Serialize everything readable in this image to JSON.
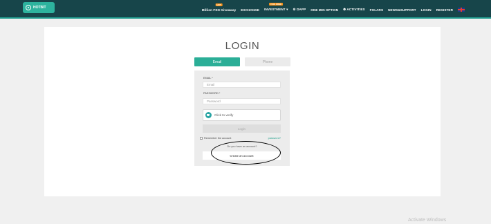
{
  "header": {
    "logo_text": "HOTBIT",
    "nav": [
      {
        "label": "Million FSN Giveaway",
        "badge": "HOT"
      },
      {
        "label": "EXCHANGE",
        "badge": ""
      },
      {
        "label": "INVESTMENT ▾",
        "badge": "FOR FREE"
      },
      {
        "label": "⚙ DAPP",
        "badge": ""
      },
      {
        "label": "ONE MIN OPTION",
        "badge": ""
      },
      {
        "label": "❁ ACTIVITIES",
        "badge": ""
      },
      {
        "label": "FOLARS",
        "badge": ""
      },
      {
        "label": "NEWS&SUPPORT",
        "badge": ""
      },
      {
        "label": "LOGIN",
        "badge": ""
      },
      {
        "label": "REGISTER",
        "badge": ""
      }
    ]
  },
  "login": {
    "title": "LOGIN",
    "tabs": {
      "email": "Email",
      "phone": "Phone"
    },
    "email_label": "EMAIL *",
    "email_placeholder": "Email",
    "password_label": "PASSWORD *",
    "password_placeholder": "Password",
    "captcha_text": "Click to verify",
    "login_button": "Login",
    "remember_label": "Remember the account",
    "forgot_link": "password?",
    "account_question": "Do you have an account?",
    "create_account": "Create an account"
  },
  "watermark": "Activate Windows",
  "colors": {
    "header_bg": "#17454a",
    "accent": "#2bae97",
    "badge": "#f7931a"
  }
}
